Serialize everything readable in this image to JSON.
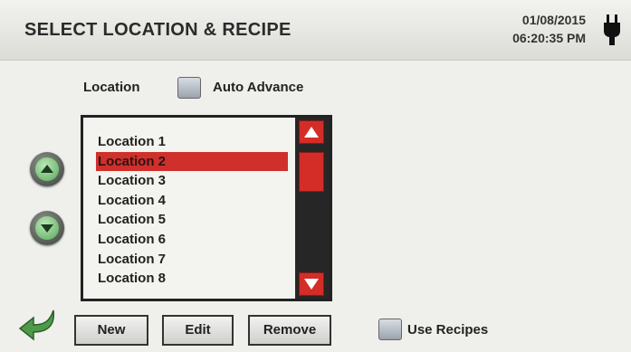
{
  "header": {
    "title": "SELECT LOCATION & RECIPE",
    "date": "01/08/2015",
    "time": "06:20:35 PM",
    "power_icon": "plug-icon"
  },
  "location": {
    "label": "Location",
    "auto_advance_label": "Auto Advance",
    "auto_advance_checked": false
  },
  "list": {
    "items": [
      "Location 1",
      "Location 2",
      "Location 3",
      "Location 4",
      "Location 5",
      "Location 6",
      "Location 7",
      "Location 8"
    ],
    "selected": "Location 2"
  },
  "buttons": {
    "new": "New",
    "edit": "Edit",
    "remove": "Remove"
  },
  "recipes": {
    "label": "Use Recipes",
    "checked": false
  },
  "colors": {
    "accent_red": "#d42d28",
    "nav_green": "#5aa85a",
    "header_bg": "#e6e6e2"
  }
}
